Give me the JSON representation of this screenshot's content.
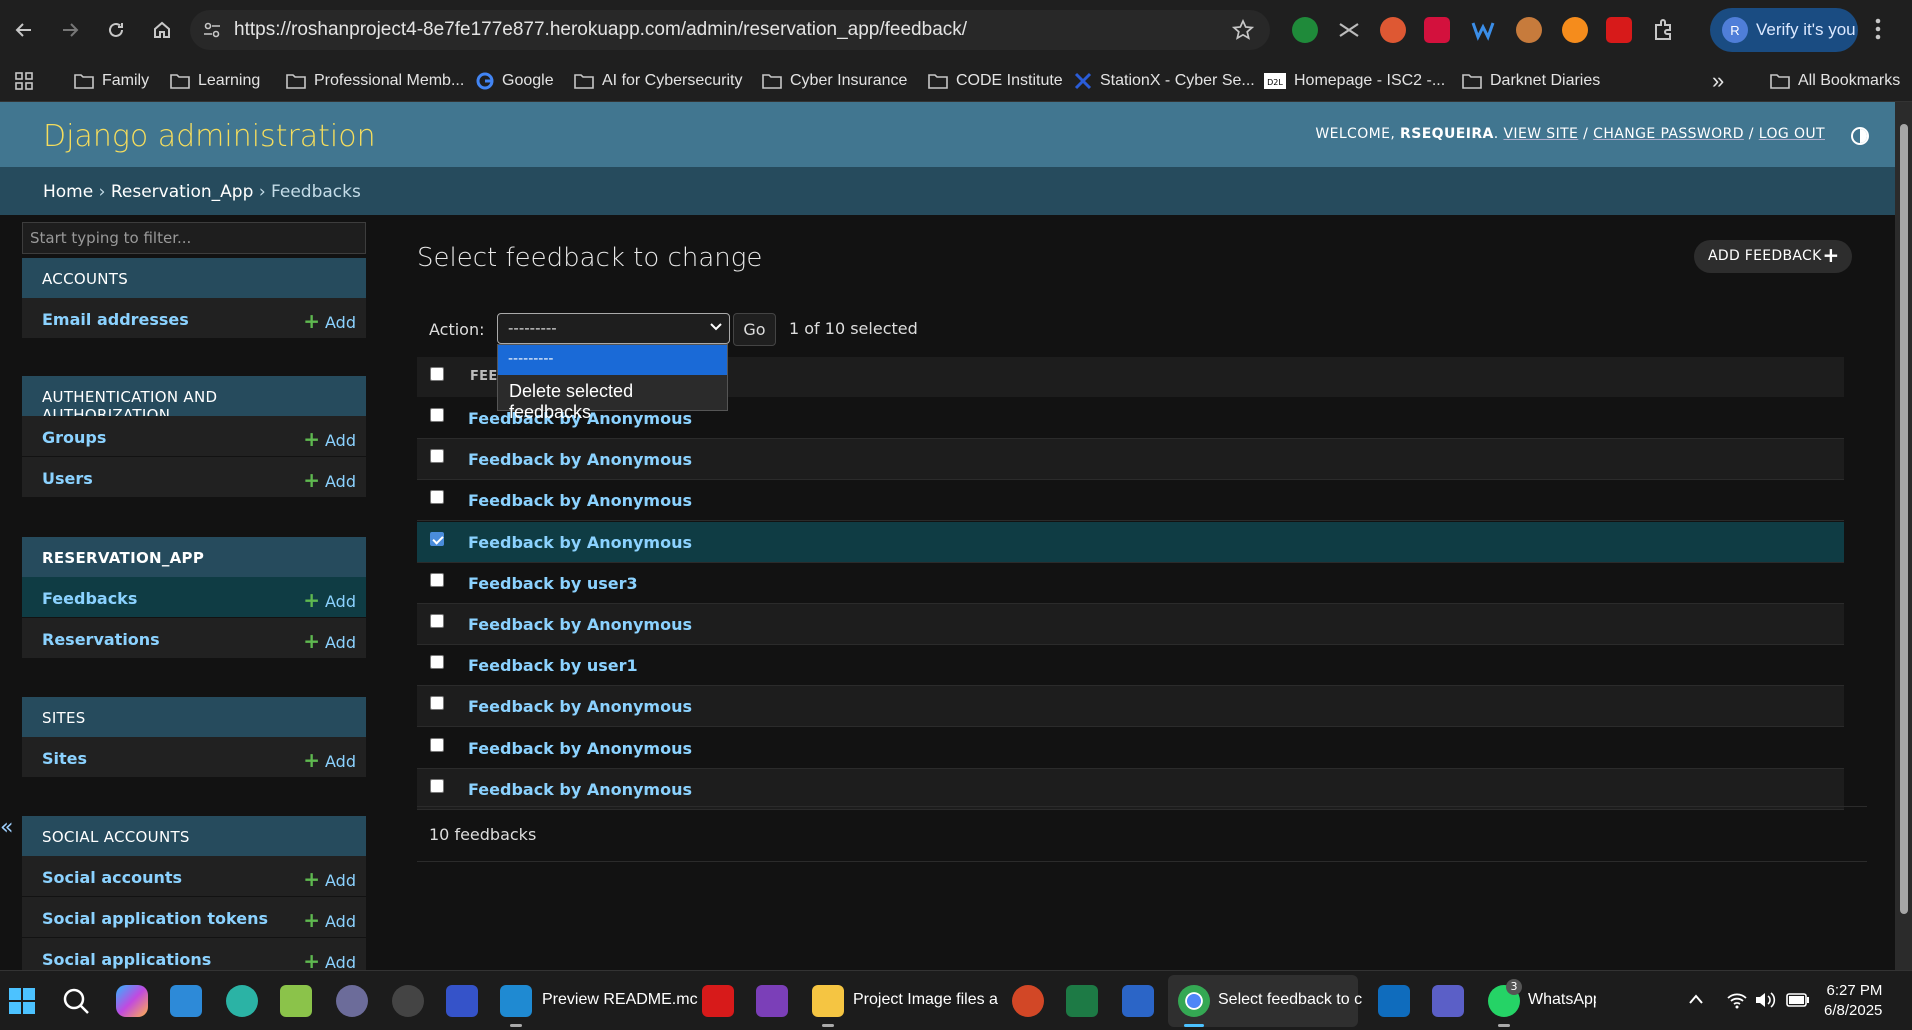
{
  "browser": {
    "url": "https://roshanproject4-8e7fe177e877.herokuapp.com/admin/reservation_app/feedback/",
    "verify_label": "Verify it's you",
    "profile_initial": "R"
  },
  "bookmarks": [
    {
      "label": "Family",
      "icon": "folder-icon"
    },
    {
      "label": "Learning",
      "icon": "folder-icon"
    },
    {
      "label": "Professional Memb...",
      "icon": "folder-icon"
    },
    {
      "label": "Google",
      "icon": "google-icon"
    },
    {
      "label": "AI for Cybersecurity",
      "icon": "folder-icon"
    },
    {
      "label": "Cyber Insurance",
      "icon": "folder-icon"
    },
    {
      "label": "CODE Institute",
      "icon": "folder-icon"
    },
    {
      "label": "StationX - Cyber Se...",
      "icon": "stationx-icon"
    },
    {
      "label": "Homepage - ISC2 -...",
      "icon": "d2l-icon"
    },
    {
      "label": "Darknet Diaries",
      "icon": "folder-icon"
    }
  ],
  "all_bookmarks": "All Bookmarks",
  "admin": {
    "brand": "Django administration",
    "welcome": "Welcome,",
    "user": "rsequeira",
    "view_site": "View site",
    "change_password": "Change password",
    "log_out": "Log out",
    "sep": "/"
  },
  "breadcrumbs": {
    "home": "Home",
    "app": "Reservation_App",
    "current": "Feedbacks",
    "sep": "›"
  },
  "sidebar": {
    "filter_placeholder": "Start typing to filter...",
    "toggle": "«",
    "add_label": "Add",
    "modules": [
      {
        "title": "Accounts",
        "items": [
          "Email addresses"
        ]
      },
      {
        "title": "Authentication and Authorization",
        "items": [
          "Groups",
          "Users"
        ]
      },
      {
        "title": "Reservation_App",
        "items": [
          "Feedbacks",
          "Reservations"
        ]
      },
      {
        "title": "Sites",
        "items": [
          "Sites"
        ]
      },
      {
        "title": "Social Accounts",
        "items": [
          "Social accounts",
          "Social application tokens",
          "Social applications"
        ]
      }
    ]
  },
  "content": {
    "title": "Select feedback to change",
    "add_button": "Add feedback",
    "action_label": "Action:",
    "action_selected": "---------",
    "go": "Go",
    "counter": "1 of 10 selected",
    "column_header": "FEEDBACK",
    "dropdown_options": [
      "---------",
      "Delete selected feedbacks"
    ],
    "rows": [
      {
        "label": "Feedback by Anonymous",
        "checked": false
      },
      {
        "label": "Feedback by Anonymous",
        "checked": false
      },
      {
        "label": "Feedback by Anonymous",
        "checked": false
      },
      {
        "label": "Feedback by Anonymous",
        "checked": true
      },
      {
        "label": "Feedback by user3",
        "checked": false
      },
      {
        "label": "Feedback by Anonymous",
        "checked": false
      },
      {
        "label": "Feedback by user1",
        "checked": false
      },
      {
        "label": "Feedback by Anonymous",
        "checked": false
      },
      {
        "label": "Feedback by Anonymous",
        "checked": false
      },
      {
        "label": "Feedback by Anonymous",
        "checked": false
      }
    ],
    "paginator": "10 feedbacks"
  },
  "taskbar": {
    "apps": [
      {
        "label": "Preview README.mc"
      },
      {
        "label": "Project Image files a"
      },
      {
        "label": "Select feedback to c"
      },
      {
        "label": "WhatsApp"
      }
    ],
    "whatsapp_badge": "3",
    "time": "6:27 PM",
    "date": "6/8/2025"
  },
  "colors": {
    "header": "#417690",
    "breadcrumbs": "#264b5d",
    "brand": "#f5dd5d",
    "link": "#8bd2ff",
    "selected_row": "#0f3c44"
  }
}
